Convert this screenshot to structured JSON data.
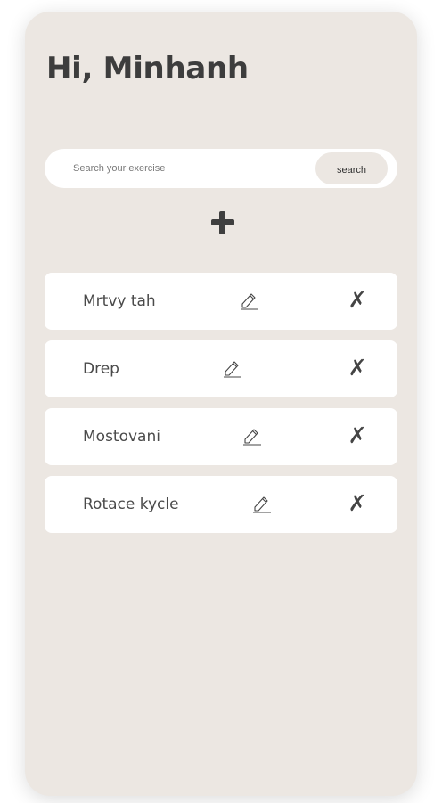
{
  "header": {
    "greeting": "Hi, Minhanh"
  },
  "search": {
    "placeholder": "Search your exercise",
    "button_label": "search"
  },
  "add": {
    "icon": "plus-icon"
  },
  "exercises": [
    {
      "name": "Mrtvy tah",
      "edit_icon": "pencil-icon",
      "delete_symbol": "✗"
    },
    {
      "name": "Drep",
      "edit_icon": "pencil-icon",
      "delete_symbol": "✗"
    },
    {
      "name": "Mostovani",
      "edit_icon": "pencil-icon",
      "delete_symbol": "✗"
    },
    {
      "name": "Rotace kycle",
      "edit_icon": "pencil-icon",
      "delete_symbol": "✗"
    }
  ],
  "colors": {
    "card_background": "#ece7e2",
    "item_background": "#ffffff",
    "text": "#3d3d3d"
  }
}
